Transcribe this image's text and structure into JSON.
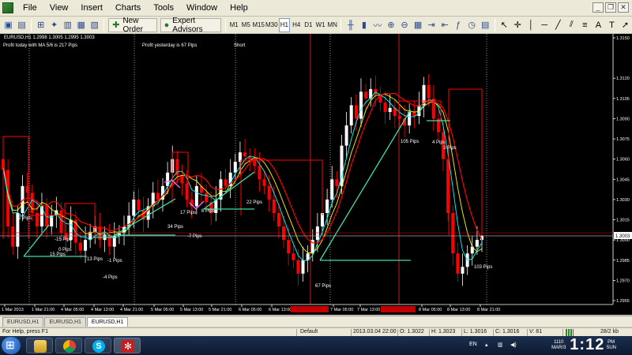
{
  "menubar": {
    "items": [
      "File",
      "View",
      "Insert",
      "Charts",
      "Tools",
      "Window",
      "Help"
    ]
  },
  "toolbar": {
    "new_order": "New Order",
    "expert_advisors": "Expert Advisors",
    "timeframes": [
      "M1",
      "M5",
      "M15",
      "M30",
      "H1",
      "H4",
      "D1",
      "W1",
      "MN"
    ],
    "active_timeframe": "H1"
  },
  "chart": {
    "title": "EURUSD,H1  1.2998 1.3005 1.2995 1.3003",
    "profit_today": "Profit today with MA 5/6 is 217 Pips",
    "profit_yesterday": "Profit yesterday is 67 Pips",
    "signal": "Short",
    "current_price": "1.3003",
    "price_axis": [
      "1.3150",
      "1.3120",
      "1.3105",
      "1.3090",
      "1.3075",
      "1.3060",
      "1.3045",
      "1.3030",
      "1.3015",
      "1.3000",
      "1.2985",
      "1.2970",
      "1.2955"
    ],
    "time_axis": [
      "1 Mar 2013",
      "1 Mar 21:00",
      "4 Mar 05:00",
      "4 Mar 13:00",
      "4 Mar 21:00",
      "5 Mar 05:00",
      "5 Mar 13:00",
      "5 Mar 21:00",
      "6 Mar 05:00",
      "6 Mar 13:00",
      "7 Mar 05:00",
      "7 Mar 13:00",
      "8 Mar 05:00",
      "8 Mar 13:00",
      "8 Mar 21:00"
    ],
    "pip_labels": [
      "32 Pips",
      "-15 Pips",
      "0 Pips",
      "15 Pips",
      "13 Pips",
      "-1 Pips",
      "-4 Pips",
      "34 Pips",
      "-7 Pips",
      "17 Pips",
      "6 Pips",
      "22 Pips",
      "67 Pips",
      "105 Pips",
      "4 Pips",
      "3 Pips",
      "103 Pips"
    ],
    "colors": {
      "background": "#000000",
      "bull_candle": "#ffffff",
      "bear_candle": "#ff0000",
      "ma_fast": "#00ffff",
      "ma_slow": "#ffff00",
      "trend": "#ff0000",
      "signal_line": "#3fe0a0",
      "signal_pink": "#ff66ff"
    }
  },
  "tabs": [
    "EURUSD,H1",
    "EURUSD,H1",
    "EURUSD,H1"
  ],
  "statusbar": {
    "help": "For Help, press F1",
    "profile": "Default",
    "datetime": "2013.03.04 22:00",
    "open": "O: 1.3022",
    "high": "H: 1.3023",
    "low": "L: 1.3016",
    "close": "C: 1.3016",
    "volume": "V: 81",
    "traffic": "28/2 kb"
  },
  "taskbar": {
    "lang": "EN",
    "clock_big": "1:12",
    "clock_ampm": "PM",
    "clock_day": "SUN",
    "clock_small": "1110 MAR/3"
  }
}
